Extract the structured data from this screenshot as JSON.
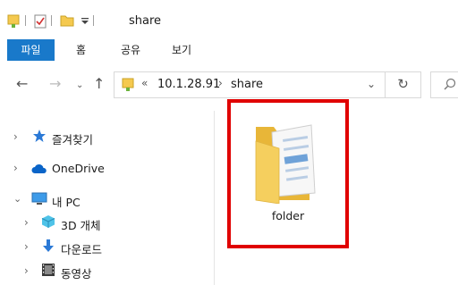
{
  "window": {
    "title": "share"
  },
  "quick_access": {
    "icons": [
      "properties-icon",
      "new-folder-icon",
      "customize-dropdown-icon"
    ]
  },
  "ribbon": {
    "file_tab": "파일",
    "tabs": [
      "홈",
      "공유",
      "보기"
    ]
  },
  "address_bar": {
    "overflow": "«",
    "segments": [
      "10.1.28.91",
      "share"
    ]
  },
  "nav_pane": {
    "items": [
      {
        "label": "즐겨찾기",
        "icon": "star-icon",
        "expanded": false
      },
      {
        "label": "OneDrive",
        "icon": "cloud-icon",
        "expanded": false
      },
      {
        "label": "내 PC",
        "icon": "computer-icon",
        "expanded": true
      },
      {
        "label": "3D 개체",
        "icon": "cube-icon",
        "expanded": false
      },
      {
        "label": "다운로드",
        "icon": "download-arrow-icon",
        "expanded": false
      },
      {
        "label": "동영상",
        "icon": "film-icon",
        "expanded": false
      }
    ]
  },
  "content": {
    "items": [
      {
        "name": "folder",
        "icon": "folder-with-documents-icon"
      }
    ]
  },
  "colors": {
    "file_tab": "#1979ca",
    "highlight": "#e00000",
    "folder": "#f5c94f"
  }
}
